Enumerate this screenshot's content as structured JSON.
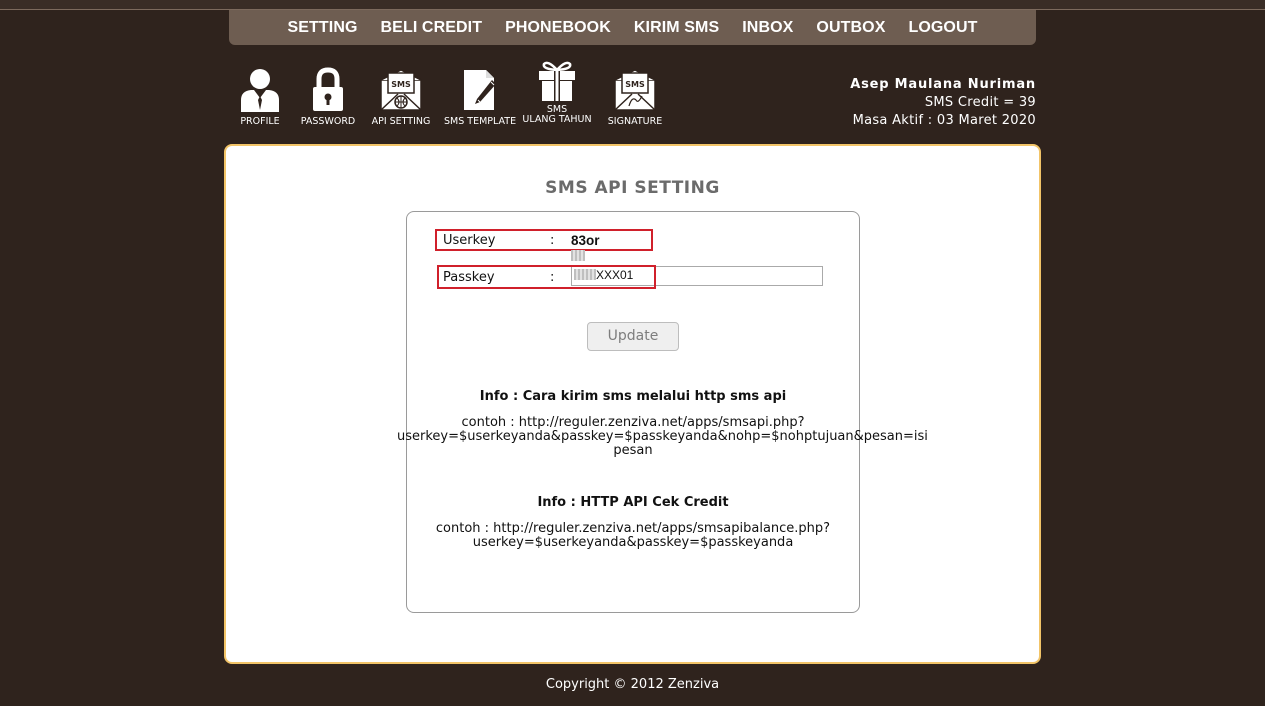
{
  "nav": {
    "items": [
      "SETTING",
      "BELI CREDIT",
      "PHONEBOOK",
      "KIRIM SMS",
      "INBOX",
      "OUTBOX",
      "LOGOUT"
    ]
  },
  "toolbar": {
    "profile": "PROFILE",
    "password": "PASSWORD",
    "api_setting": "API SETTING",
    "sms_template": "SMS TEMPLATE",
    "sms_ulang_tahun_1": "SMS",
    "sms_ulang_tahun_2": "ULANG TAHUN",
    "signature": "SIGNATURE",
    "icon_sms_text": "SMS"
  },
  "user": {
    "name": "Asep Maulana Nuriman",
    "credit": "SMS Credit = 39",
    "masa_aktif": "Masa Aktif : 03 Maret 2020"
  },
  "panel": {
    "title": "SMS API SETTING",
    "userkey_label": "Userkey",
    "userkey_colon": ":",
    "userkey_value": "83or",
    "passkey_label": "Passkey",
    "passkey_colon": ":",
    "passkey_value": "XXX01",
    "update_label": "Update",
    "info1_title": "Info : Cara kirim sms melalui http sms api",
    "info1_line1": "contoh : http://reguler.zenziva.net/apps/smsapi.php?",
    "info1_line2": "userkey=$userkeyanda&passkey=$passkeyanda&nohp=$nohptujuan&pesan=isi",
    "info1_line3": "pesan",
    "info2_title": "Info : HTTP API Cek Credit",
    "info2_line1": "contoh : http://reguler.zenziva.net/apps/smsapibalance.php?",
    "info2_line2": "userkey=$userkeyanda&passkey=$passkeyanda"
  },
  "footer": {
    "text": "Copyright © 2012 Zenziva"
  },
  "colors": {
    "background": "#2f231d",
    "navbar": "#6e5d51",
    "panel_border": "#f2c468",
    "highlight": "#d0202b"
  }
}
